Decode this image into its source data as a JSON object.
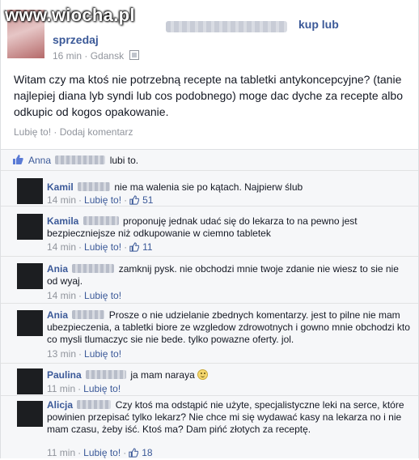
{
  "watermark": "www.wiocha.pl",
  "post": {
    "title_right": "kup lub",
    "title_second": "sprzedaj",
    "time": "16 min",
    "place": "Gdansk",
    "body": "Witam czy ma ktoś nie potrzebną recepte na tabletki antykoncepcyjne? (tanie najlepiej diana lyb syndi lub cos podobnego) moge dac dyche za recepte albo odkupic od kogos opakowanie.",
    "like_label": "Lubię to!",
    "comment_label": "Dodaj komentarz",
    "separator": "·"
  },
  "likes": {
    "first_name": "Anna",
    "suffix": "lubi to."
  },
  "meta": {
    "like_label": "Lubię to!",
    "separator": "·"
  },
  "comments": [
    {
      "author": "Kamil",
      "text": "nie ma walenia sie po kątach. Najpierw ślub",
      "time": "14 min",
      "likes": "51"
    },
    {
      "author": "Kamila",
      "text": "proponuję jednak udać się do lekarza to na pewno jest bezpieczniejsze niż odkupowanie w ciemno tabletek",
      "time": "14 min",
      "likes": "11"
    },
    {
      "author": "Ania",
      "text": "zamknij pysk. nie obchodzi mnie twoje zdanie nie wiesz to sie nie od wyaj.",
      "time": "14 min",
      "likes": ""
    },
    {
      "author": "Ania",
      "text": "Prosze o nie udzielanie zbednych komentarzy. jest to pilne nie mam ubezpieczenia, a tabletki biore ze wzgledow zdrowotnych i gowno mnie obchodzi kto co mysli tlumaczyc sie nie bede. tylko powazne oferty. jol.",
      "time": "13 min",
      "likes": ""
    },
    {
      "author": "Paulina",
      "text": "ja mam naraya",
      "time": "11 min",
      "likes": ""
    },
    {
      "author": "Alicja",
      "text": "Czy ktoś ma odstąpić nie użyte, specjalistyczne leki na serce, które powinien przepisać tylko lekarz? Nie chce mi się wydawać kasy na lekarza no i nie mam czasu, żeby iść. Ktoś ma? Dam pińć złotych za receptę.",
      "time": "11 min",
      "likes": "18"
    }
  ],
  "icons": {
    "thumb": "thumbs-up-icon",
    "map": "map-icon",
    "smiley": "smiley-icon"
  },
  "colors": {
    "link": "#3b5998",
    "meta": "#90949c",
    "comment_bg": "#f6f7f9"
  }
}
